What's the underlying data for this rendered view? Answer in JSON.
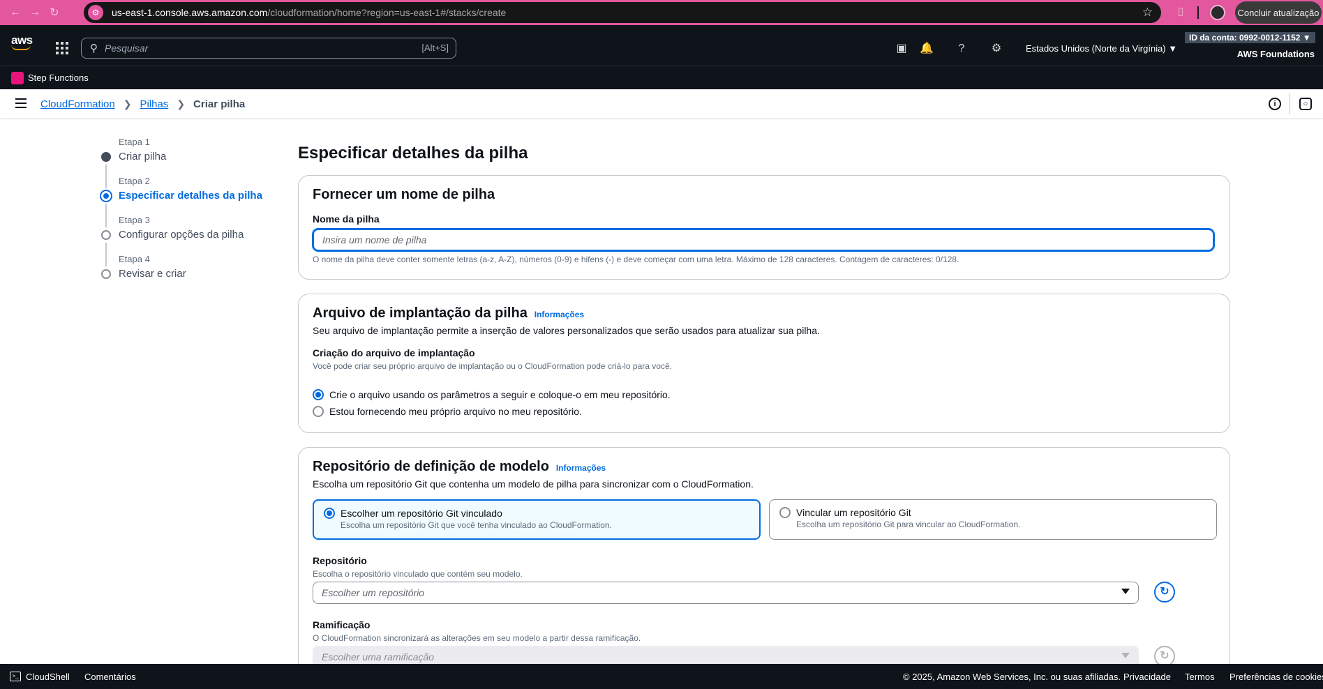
{
  "browser": {
    "url_host": "us-east-1.console.aws.amazon.com",
    "url_path": "/cloudformation/home?region=us-east-1#/stacks/create",
    "update_label": "Concluir atualização"
  },
  "topnav": {
    "logo": "aws",
    "search_placeholder": "Pesquisar",
    "search_shortcut": "[Alt+S]",
    "region": "Estados Unidos (Norte da Virgínia) ▼",
    "account_id": "ID da conta: 0992-0012-1152 ▼",
    "org": "AWS Foundations"
  },
  "favorites": {
    "items": [
      {
        "label": "Step Functions",
        "icon": "step-functions-icon"
      }
    ]
  },
  "breadcrumb": {
    "items": [
      "CloudFormation",
      "Pilhas"
    ],
    "current": "Criar pilha"
  },
  "steps": [
    {
      "label": "Etapa 1",
      "title": "Criar pilha",
      "state": "done"
    },
    {
      "label": "Etapa 2",
      "title": "Especificar detalhes da pilha",
      "state": "active"
    },
    {
      "label": "Etapa 3",
      "title": "Configurar opções da pilha",
      "state": "pending"
    },
    {
      "label": "Etapa 4",
      "title": "Revisar e criar",
      "state": "pending"
    }
  ],
  "page_title": "Especificar detalhes da pilha",
  "stack_name": {
    "heading": "Fornecer um nome de pilha",
    "label": "Nome da pilha",
    "placeholder": "Insira um nome de pilha",
    "constraint": "O nome da pilha deve conter somente letras (a-z, A-Z), números (0-9) e hifens (-) e deve começar com uma letra. Máximo de 128 caracteres. Contagem de caracteres: 0/128."
  },
  "deployment_file": {
    "heading": "Arquivo de implantação da pilha",
    "info": "Informações",
    "description": "Seu arquivo de implantação permite a inserção de valores personalizados que serão usados para atualizar sua pilha.",
    "field_label": "Criação do arquivo de implantação",
    "field_desc": "Você pode criar seu próprio arquivo de implantação ou o CloudFormation pode criá-lo para você.",
    "options": [
      {
        "label": "Crie o arquivo usando os parâmetros a seguir e coloque-o em meu repositório.",
        "selected": true
      },
      {
        "label": "Estou fornecendo meu próprio arquivo no meu repositório.",
        "selected": false
      }
    ]
  },
  "template_repo": {
    "heading": "Repositório de definição de modelo",
    "info": "Informações",
    "description": "Escolha um repositório Git que contenha um modelo de pilha para sincronizar com o CloudFormation.",
    "tiles": [
      {
        "title": "Escolher um repositório Git vinculado",
        "desc": "Escolha um repositório Git que você tenha vinculado ao CloudFormation.",
        "selected": true
      },
      {
        "title": "Vincular um repositório Git",
        "desc": "Escolha um repositório Git para vincular ao CloudFormation.",
        "selected": false
      }
    ],
    "repo_label": "Repositório",
    "repo_desc": "Escolha o repositório vinculado que contém seu modelo.",
    "repo_placeholder": "Escolher um repositório",
    "branch_label": "Ramificação",
    "branch_desc": "O CloudFormation sincronizará as alterações em seu modelo a partir dessa ramificação.",
    "branch_placeholder": "Escolher uma ramificação"
  },
  "footer": {
    "cloudshell": "CloudShell",
    "feedback": "Comentários",
    "copyright": "© 2025, Amazon Web Services, Inc. ou suas afiliadas.",
    "privacy": "Privacidade",
    "terms": "Termos",
    "cookies": "Preferências de cookies"
  },
  "colors": {
    "accent": "#006ce0",
    "nav_bg": "#0f141a",
    "browser_frame": "#e3579f"
  }
}
